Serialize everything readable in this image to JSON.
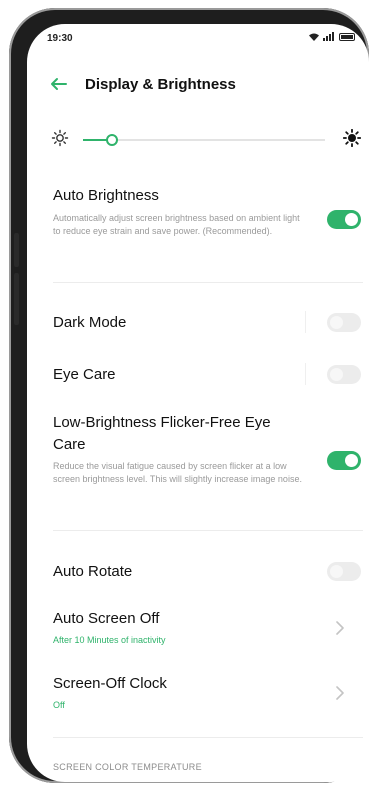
{
  "status_bar": {
    "time": "19:30"
  },
  "header": {
    "title": "Display & Brightness"
  },
  "brightness": {
    "level": 0.12
  },
  "rows": {
    "auto_brightness": {
      "label": "Auto Brightness",
      "description": "Automatically adjust screen brightness based on ambient light to reduce eye strain and save power. (Recommended).",
      "enabled": true
    },
    "dark_mode": {
      "label": "Dark Mode",
      "enabled": false
    },
    "eye_care": {
      "label": "Eye Care",
      "enabled": false
    },
    "flicker_free": {
      "label": "Low-Brightness Flicker-Free Eye Care",
      "description": "Reduce the visual fatigue caused by screen flicker at a low screen brightness level. This will slightly increase image noise.",
      "enabled": true
    },
    "auto_rotate": {
      "label": "Auto Rotate",
      "enabled": false
    },
    "auto_screen_off": {
      "label": "Auto Screen Off",
      "value": "After 10 Minutes of inactivity"
    },
    "screen_off_clock": {
      "label": "Screen-Off Clock",
      "value": "Off"
    }
  },
  "section": {
    "color_temperature": "SCREEN COLOR TEMPERATURE"
  },
  "colors": {
    "accent": "#2fb36b",
    "toggle_off": "#ececec",
    "text": "#111111",
    "muted": "#9a9a9a"
  },
  "icons": [
    "back-arrow-icon",
    "brightness-low-icon",
    "brightness-high-icon",
    "wifi-icon",
    "signal-icon",
    "battery-icon",
    "chevron-right-icon"
  ]
}
